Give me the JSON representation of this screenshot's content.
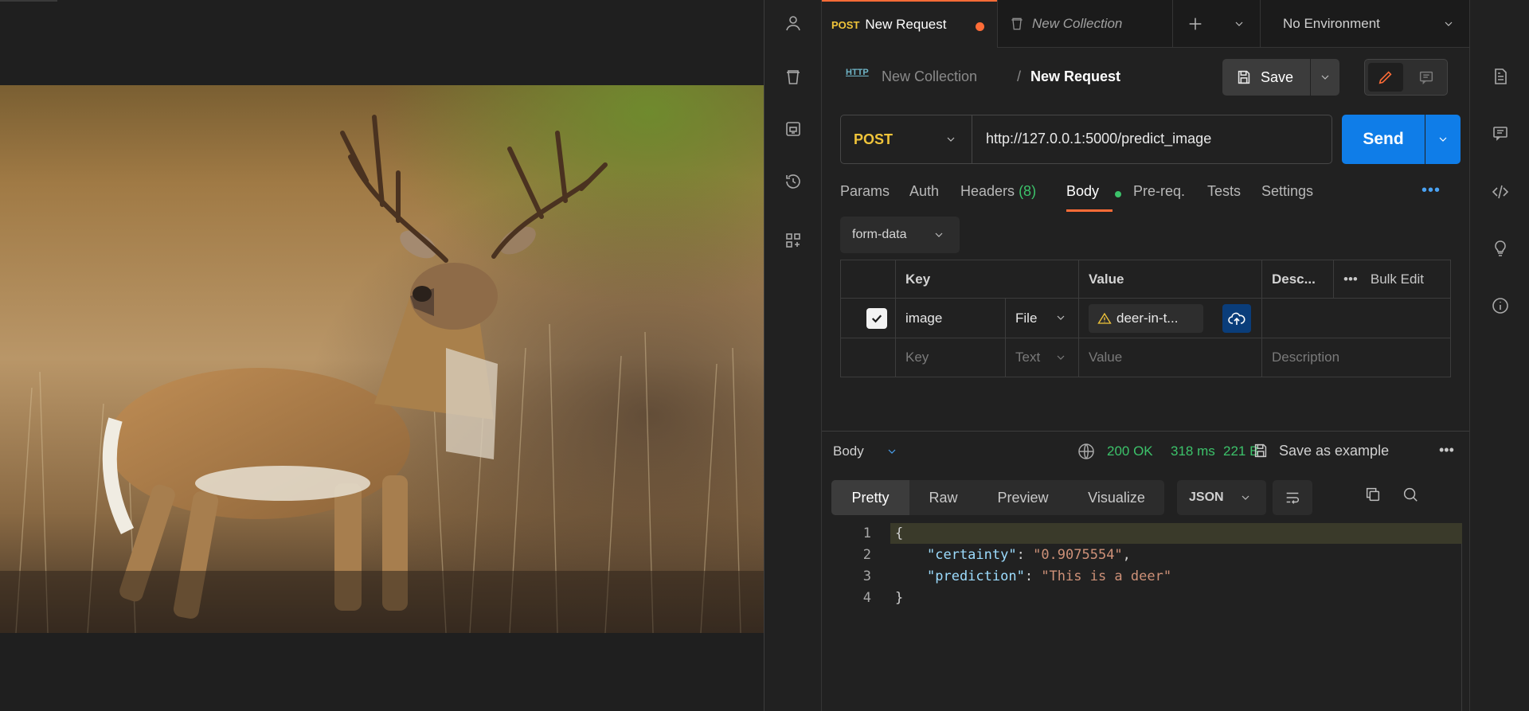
{
  "tabs": {
    "active": {
      "method": "POST",
      "title": "New Request"
    },
    "collection_tab": "New Collection",
    "environment": "No Environment"
  },
  "breadcrumb": {
    "http_icon": "HTTP",
    "collection": "New Collection",
    "separator": "/",
    "request": "New Request"
  },
  "toolbar": {
    "save_label": "Save"
  },
  "request": {
    "method": "POST",
    "url": "http://127.0.0.1:5000/predict_image",
    "send_label": "Send"
  },
  "request_tabs": {
    "params": "Params",
    "auth": "Auth",
    "headers": "Headers",
    "headers_count": "(8)",
    "body": "Body",
    "prereq": "Pre-req.",
    "tests": "Tests",
    "settings": "Settings",
    "more": "•••"
  },
  "body_type": "form-data",
  "table": {
    "headers": {
      "key": "Key",
      "value": "Value",
      "description": "Desc...",
      "bulk_edit": "Bulk Edit",
      "more": "•••"
    },
    "rows": [
      {
        "checked": true,
        "key": "image",
        "type": "File",
        "value": "deer-in-t..."
      }
    ],
    "placeholders": {
      "key": "Key",
      "type": "Text",
      "value": "Value",
      "description": "Description"
    }
  },
  "response": {
    "body_label": "Body",
    "status": "200 OK",
    "time": "318 ms",
    "size": "221 B",
    "save_example": "Save as example",
    "more": "•••",
    "view_tabs": [
      "Pretty",
      "Raw",
      "Preview",
      "Visualize"
    ],
    "format": "JSON",
    "lines": [
      "1",
      "2",
      "3",
      "4"
    ],
    "json": {
      "open": "{",
      "k1": "\"certainty\"",
      "v1": "\"0.9075554\"",
      "k2": "\"prediction\"",
      "v2": "\"This is a deer\"",
      "close": "}"
    }
  },
  "colors": {
    "accent_orange": "#ff6c37",
    "send_blue": "#0f7de8",
    "method_yellow": "#f0c43a",
    "success_green": "#3cc26a"
  },
  "icons": {
    "left_sidebar": [
      "user-icon",
      "trash-icon",
      "mock-server-icon",
      "history-icon",
      "add-widget-icon"
    ],
    "right_sidebar": [
      "documentation-icon",
      "comments-icon",
      "code-icon",
      "lightbulb-icon",
      "info-icon"
    ]
  }
}
